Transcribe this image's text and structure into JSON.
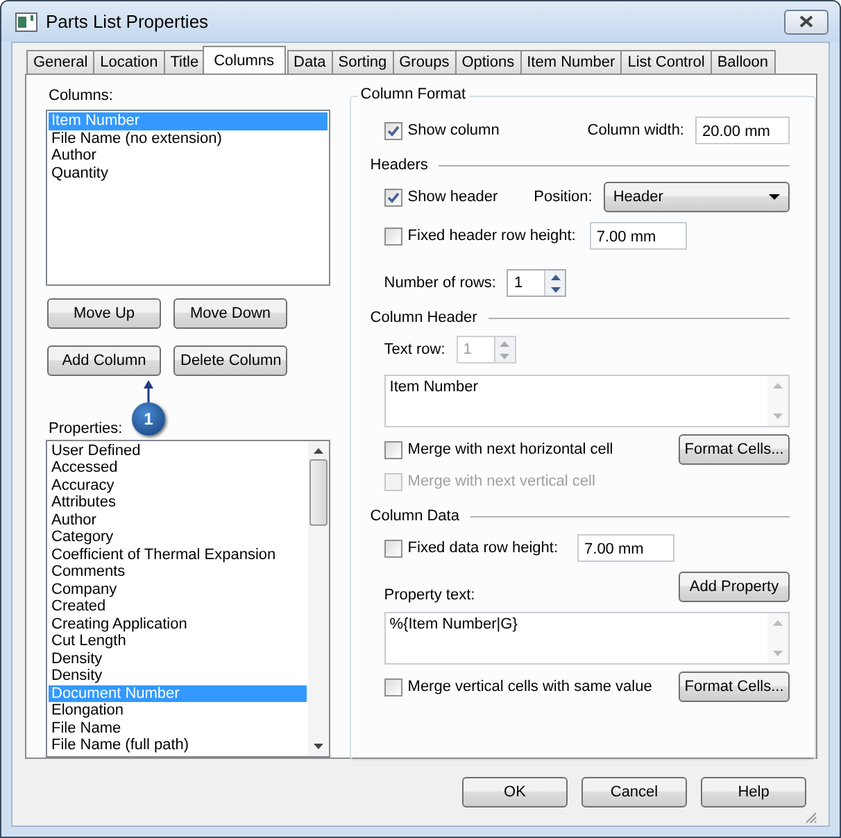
{
  "window": {
    "title": "Parts List Properties"
  },
  "tabs": [
    {
      "label": "General",
      "selected": false
    },
    {
      "label": "Location",
      "selected": false
    },
    {
      "label": "Title",
      "selected": false
    },
    {
      "label": "Columns",
      "selected": true
    },
    {
      "label": "Data",
      "selected": false
    },
    {
      "label": "Sorting",
      "selected": false
    },
    {
      "label": "Groups",
      "selected": false
    },
    {
      "label": "Options",
      "selected": false
    },
    {
      "label": "Item Number",
      "selected": false
    },
    {
      "label": "List Control",
      "selected": false
    },
    {
      "label": "Balloon",
      "selected": false
    }
  ],
  "columns": {
    "label": "Columns:",
    "items": [
      {
        "label": "Item Number",
        "selected": true
      },
      {
        "label": "File Name (no extension)",
        "selected": false
      },
      {
        "label": "Author",
        "selected": false
      },
      {
        "label": "Quantity",
        "selected": false
      }
    ]
  },
  "column_buttons": [
    "Move Up",
    "Move Down",
    "Add Column",
    "Delete Column"
  ],
  "callout": {
    "label": "1"
  },
  "properties": {
    "label": "Properties:",
    "items": [
      {
        "label": "User Defined",
        "selected": false
      },
      {
        "label": "Accessed",
        "selected": false
      },
      {
        "label": "Accuracy",
        "selected": false
      },
      {
        "label": "Attributes",
        "selected": false
      },
      {
        "label": "Author",
        "selected": false
      },
      {
        "label": "Category",
        "selected": false
      },
      {
        "label": "Coefficient of Thermal Expansion",
        "selected": false
      },
      {
        "label": "Comments",
        "selected": false
      },
      {
        "label": "Company",
        "selected": false
      },
      {
        "label": "Created",
        "selected": false
      },
      {
        "label": "Creating Application",
        "selected": false
      },
      {
        "label": "Cut Length",
        "selected": false
      },
      {
        "label": "Density",
        "selected": false
      },
      {
        "label": "Density",
        "selected": false
      },
      {
        "label": "Document Number",
        "selected": true
      },
      {
        "label": "Elongation",
        "selected": false
      },
      {
        "label": "File Name",
        "selected": false
      },
      {
        "label": "File Name (full path)",
        "selected": false
      }
    ]
  },
  "column_format": {
    "title": "Column Format",
    "show_column": {
      "label": "Show column",
      "checked": true,
      "disabled": false
    },
    "column_width": {
      "label": "Column width:",
      "value": "20.00 mm"
    }
  },
  "headers": {
    "title": "Headers",
    "show_header": {
      "label": "Show header",
      "checked": true,
      "disabled": false
    },
    "position": {
      "label": "Position:",
      "value": "Header"
    },
    "fixed_header_row_height": {
      "label": "Fixed header row height:",
      "checked": false,
      "disabled": false,
      "value": "7.00 mm"
    },
    "number_of_rows": {
      "label": "Number of rows:",
      "value": "1",
      "disabled": false
    }
  },
  "column_header": {
    "title": "Column Header",
    "text_row": {
      "label": "Text row:",
      "value": "1",
      "disabled": true
    },
    "text": "Item Number",
    "merge_horizontal": {
      "label": "Merge with next horizontal cell",
      "checked": false,
      "disabled": false
    },
    "format_cells": "Format Cells...",
    "merge_vertical": {
      "label": "Merge with next vertical cell",
      "checked": false,
      "disabled": true
    }
  },
  "column_data": {
    "title": "Column Data",
    "fixed_data_row_height": {
      "label": "Fixed data row height:",
      "checked": false,
      "disabled": false,
      "value": "7.00 mm"
    },
    "add_property": "Add Property",
    "property_text_label": "Property text:",
    "property_text": "%{Item Number|G}",
    "merge_same_value": {
      "label": "Merge vertical cells with same value",
      "checked": false,
      "disabled": false
    },
    "format_cells": "Format Cells..."
  },
  "buttons": [
    "OK",
    "Cancel",
    "Help"
  ]
}
